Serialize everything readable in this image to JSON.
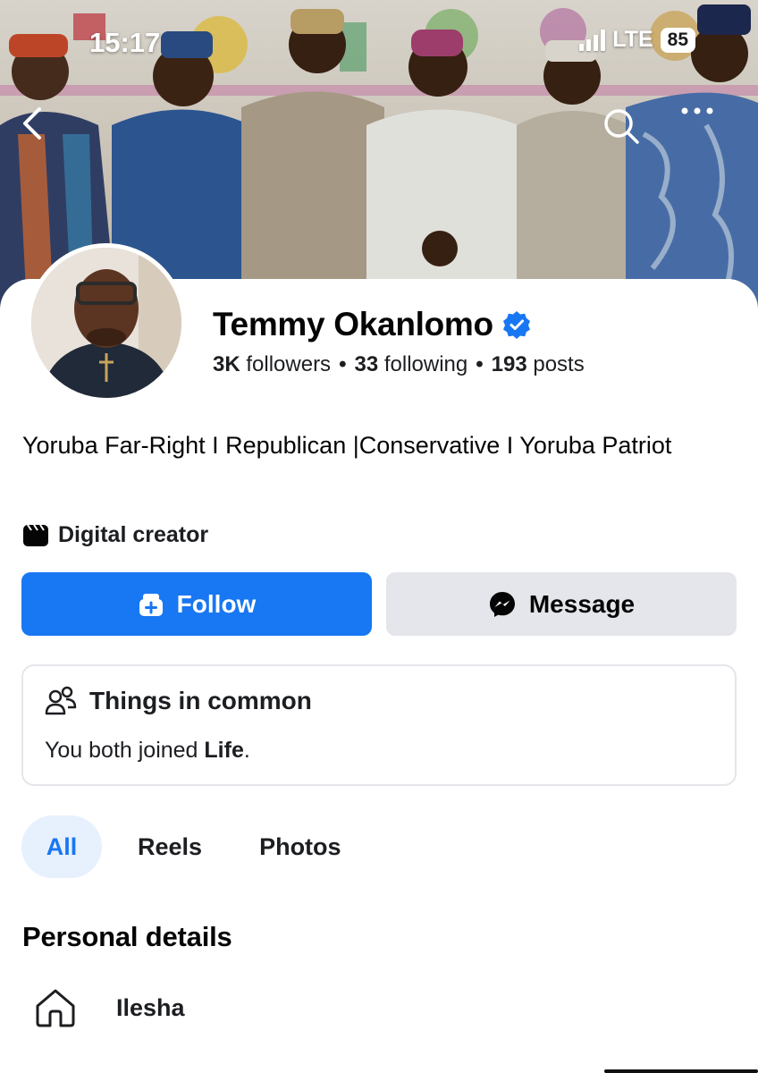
{
  "status_bar": {
    "time": "15:17",
    "network": "LTE",
    "battery": "85"
  },
  "cover": {
    "icons": [
      "back-arrow-icon",
      "search-icon",
      "more-horizontal-icon"
    ]
  },
  "profile": {
    "name": "Temmy Okanlomo",
    "verified": true,
    "followers_count": "3K",
    "followers_label": "followers",
    "following_count": "33",
    "following_label": "following",
    "posts_count": "193",
    "posts_label": "posts",
    "separator": "•",
    "bio": "Yoruba Far-Right I Republican |Conservative  I Yoruba Patriot",
    "category": "Digital creator"
  },
  "actions": {
    "follow_label": "Follow",
    "message_label": "Message"
  },
  "things_in_common": {
    "title": "Things in common",
    "text_prefix": "You both joined ",
    "text_group": "Life",
    "text_suffix": "."
  },
  "tabs": [
    {
      "label": "All",
      "active": true
    },
    {
      "label": "Reels",
      "active": false
    },
    {
      "label": "Photos",
      "active": false
    }
  ],
  "personal_details": {
    "title": "Personal details",
    "items": [
      {
        "icon": "home-icon",
        "text": "Ilesha"
      }
    ]
  },
  "colors": {
    "accent": "#1877f2",
    "secondary_button": "#e4e6eb",
    "active_tab_bg": "#e7f0fd",
    "text": "#050505"
  }
}
